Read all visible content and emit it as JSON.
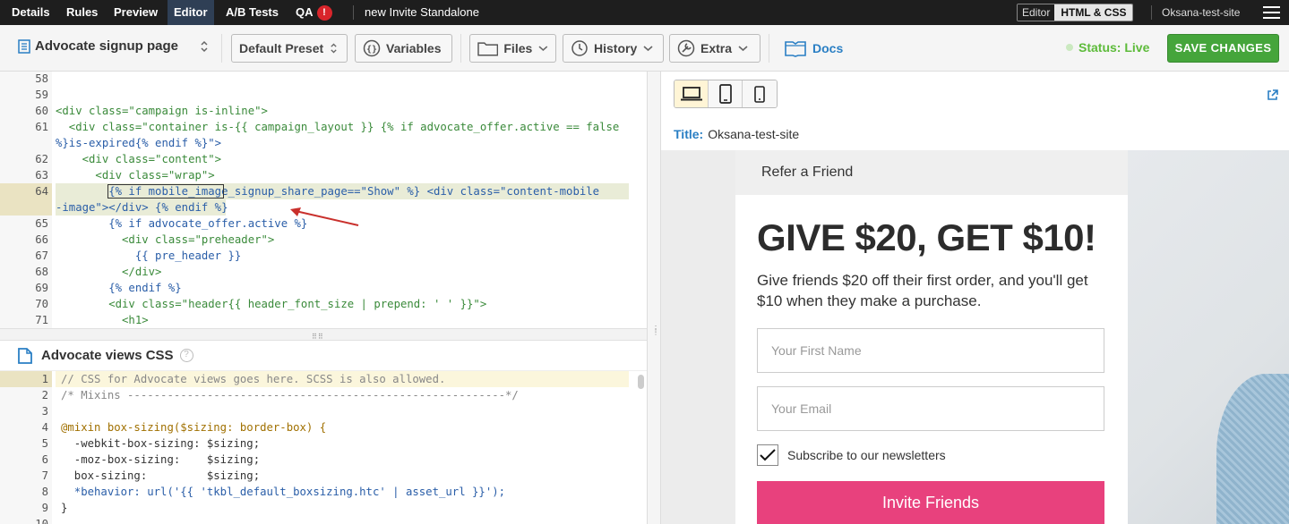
{
  "topnav": {
    "items": [
      {
        "label": "Details"
      },
      {
        "label": "Rules"
      },
      {
        "label": "Preview"
      },
      {
        "label": "Editor"
      },
      {
        "label": "A/B Tests"
      },
      {
        "label": "QA"
      }
    ],
    "qa_badge": "!",
    "doc_title": "new Invite Standalone",
    "mode_off": "Editor",
    "mode_on": "HTML & CSS",
    "site_name": "Oksana-test-site"
  },
  "toolbar": {
    "page_select": "Advocate signup page",
    "preset": "Default Preset",
    "variables": "Variables",
    "files": "Files",
    "history": "History",
    "extra": "Extra",
    "docs": "Docs",
    "status": "Status: Live",
    "save": "SAVE CHANGES"
  },
  "html_editor": {
    "lines": [
      {
        "n": "58",
        "t": ""
      },
      {
        "n": "59",
        "t": ""
      },
      {
        "n": "60",
        "t": "<div class=\"campaign is-inline\">"
      },
      {
        "n": "61",
        "t": "  <div class=\"container is-{{ campaign_layout }} {% if advocate_offer.active == false"
      },
      {
        "n": "",
        "t": "%}is-expired{% endif %}\">"
      },
      {
        "n": "62",
        "t": "    <div class=\"content\">"
      },
      {
        "n": "63",
        "t": "      <div class=\"wrap\">"
      },
      {
        "n": "64",
        "t": "        {% if mobile_image_signup_share_page==\"Show\" %} <div class=\"content-mobile"
      },
      {
        "n": "",
        "t": "-image\"></div> {% endif %}"
      },
      {
        "n": "65",
        "t": "        {% if advocate_offer.active %}"
      },
      {
        "n": "66",
        "t": "          <div class=\"preheader\">"
      },
      {
        "n": "67",
        "t": "            {{ pre_header }}"
      },
      {
        "n": "68",
        "t": "          </div>"
      },
      {
        "n": "69",
        "t": "        {% endif %}"
      },
      {
        "n": "70",
        "t": "        <div class=\"header{{ header_font_size | prepend: ' ' }}\">"
      },
      {
        "n": "71",
        "t": "          <h1>"
      }
    ]
  },
  "css_panel": {
    "title": "Advocate views CSS",
    "help": "?",
    "lines": [
      {
        "n": "1",
        "t": "// CSS for Advocate views goes here. SCSS is also allowed."
      },
      {
        "n": "2",
        "t": "/* Mixins ---------------------------------------------------------*/"
      },
      {
        "n": "3",
        "t": ""
      },
      {
        "n": "4",
        "t": "@mixin box-sizing($sizing: border-box) {"
      },
      {
        "n": "5",
        "t": "  -webkit-box-sizing: $sizing;"
      },
      {
        "n": "6",
        "t": "  -moz-box-sizing:    $sizing;"
      },
      {
        "n": "7",
        "t": "  box-sizing:         $sizing;"
      },
      {
        "n": "8",
        "t": "  *behavior: url('{{ 'tkbl_default_boxsizing.htc' | asset_url }}');"
      },
      {
        "n": "9",
        "t": "}"
      },
      {
        "n": "10",
        "t": ""
      }
    ]
  },
  "preview": {
    "title_label": "Title:",
    "title_value": "Oksana-test-site",
    "card_header": "Refer a Friend",
    "headline": "GIVE $20, GET $10!",
    "subtext": "Give friends $20 off their first order, and you'll get $10 when they make a purchase.",
    "first_name_placeholder": "Your First Name",
    "email_placeholder": "Your Email",
    "subscribe_label": "Subscribe to our newsletters",
    "invite_button": "Invite Friends"
  },
  "colors": {
    "accent_blue": "#2a7fc4",
    "save_green": "#45a53b",
    "status_green": "#5dbb3a",
    "invite_pink": "#e8417d",
    "qa_red": "#d9252b",
    "annotation_arrow": "#c9302c"
  }
}
